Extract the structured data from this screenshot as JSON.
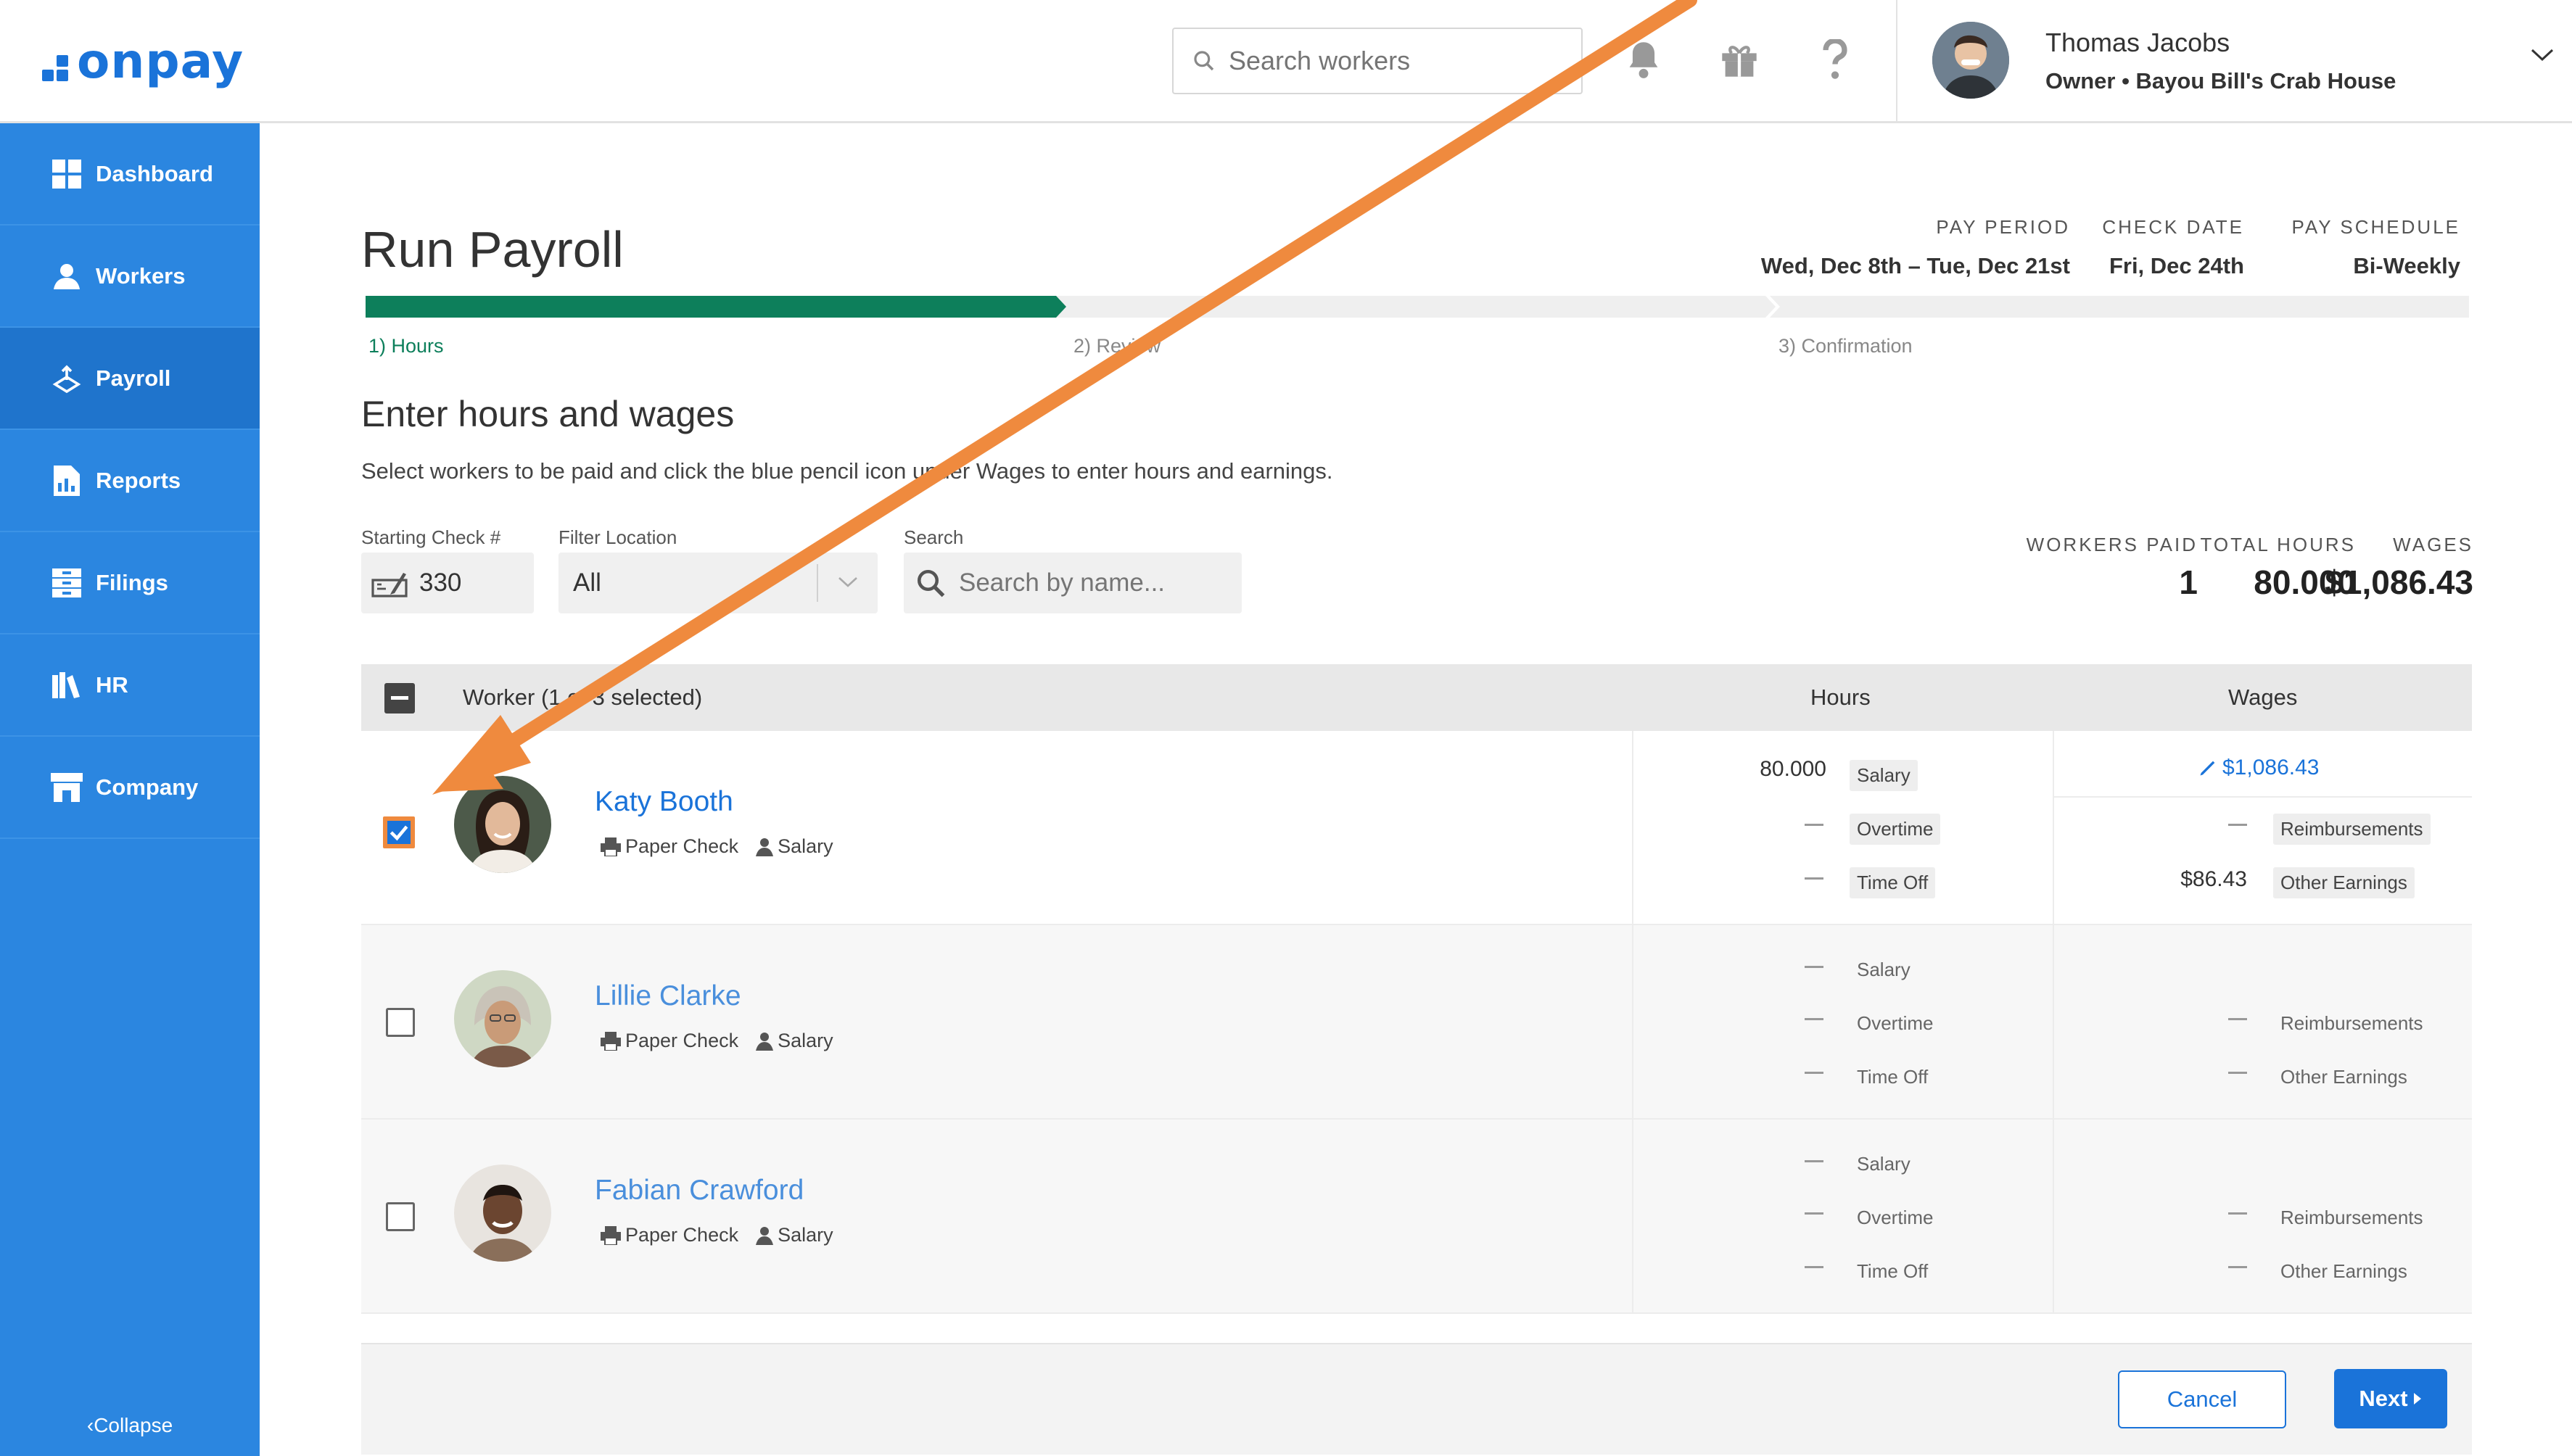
{
  "header": {
    "logo": "onpay",
    "search_placeholder": "Search workers",
    "user_name": "Thomas Jacobs",
    "user_role": "Owner • Bayou Bill's Crab House"
  },
  "sidebar": {
    "items": [
      {
        "label": "Dashboard",
        "icon": "dashboard-icon"
      },
      {
        "label": "Workers",
        "icon": "workers-icon"
      },
      {
        "label": "Payroll",
        "icon": "payroll-icon",
        "active": true
      },
      {
        "label": "Reports",
        "icon": "reports-icon"
      },
      {
        "label": "Filings",
        "icon": "filings-icon"
      },
      {
        "label": "HR",
        "icon": "hr-icon"
      },
      {
        "label": "Company",
        "icon": "company-icon"
      }
    ],
    "collapse": "Collapse"
  },
  "page": {
    "title": "Run Payroll",
    "pay_period_label": "PAY PERIOD",
    "pay_period": "Wed, Dec 8th – Tue, Dec 21st",
    "check_date_label": "CHECK DATE",
    "check_date": "Fri, Dec 24th",
    "pay_schedule_label": "PAY SCHEDULE",
    "pay_schedule": "Bi-Weekly",
    "steps": [
      "1) Hours",
      "2) Review",
      "3) Confirmation"
    ],
    "progress_fraction": 0.333,
    "section_title": "Enter hours and wages",
    "section_desc": "Select workers to be paid and click the blue pencil icon under Wages to enter hours and earnings."
  },
  "filters": {
    "starting_check_label": "Starting Check #",
    "starting_check": "330",
    "location_label": "Filter Location",
    "location": "All",
    "search_label": "Search",
    "search_placeholder": "Search by name..."
  },
  "stats": {
    "workers_paid_label": "WORKERS PAID",
    "workers_paid": "1",
    "total_hours_label": "TOTAL HOURS",
    "total_hours": "80.000",
    "wages_label": "WAGES",
    "wages": "$1,086.43"
  },
  "table": {
    "worker_header": "Worker (1 of 3 selected)",
    "hours_header": "Hours",
    "wages_header": "Wages",
    "rows": [
      {
        "name": "Katy Booth",
        "payment": "Paper Check",
        "type": "Salary",
        "checked": true,
        "salary_hours": "80.000",
        "salary_tag": "Salary",
        "overtime_tag": "Overtime",
        "timeoff_tag": "Time Off",
        "wage": "$1,086.43",
        "reimb_tag": "Reimbursements",
        "other_amount": "$86.43",
        "other_tag": "Other Earnings"
      },
      {
        "name": "Lillie Clarke",
        "payment": "Paper Check",
        "type": "Salary",
        "checked": false,
        "salary_tag": "Salary",
        "overtime_tag": "Overtime",
        "timeoff_tag": "Time Off",
        "reimb_tag": "Reimbursements",
        "other_tag": "Other Earnings"
      },
      {
        "name": "Fabian Crawford",
        "payment": "Paper Check",
        "type": "Salary",
        "checked": false,
        "salary_tag": "Salary",
        "overtime_tag": "Overtime",
        "timeoff_tag": "Time Off",
        "reimb_tag": "Reimbursements",
        "other_tag": "Other Earnings"
      }
    ]
  },
  "footer": {
    "cancel": "Cancel",
    "next": "Next"
  },
  "colors": {
    "brand_blue": "#1a73d9",
    "sidebar_blue": "#2b86e0",
    "progress_green": "#0d7f5b",
    "annotation_orange": "#ef8a3e"
  }
}
